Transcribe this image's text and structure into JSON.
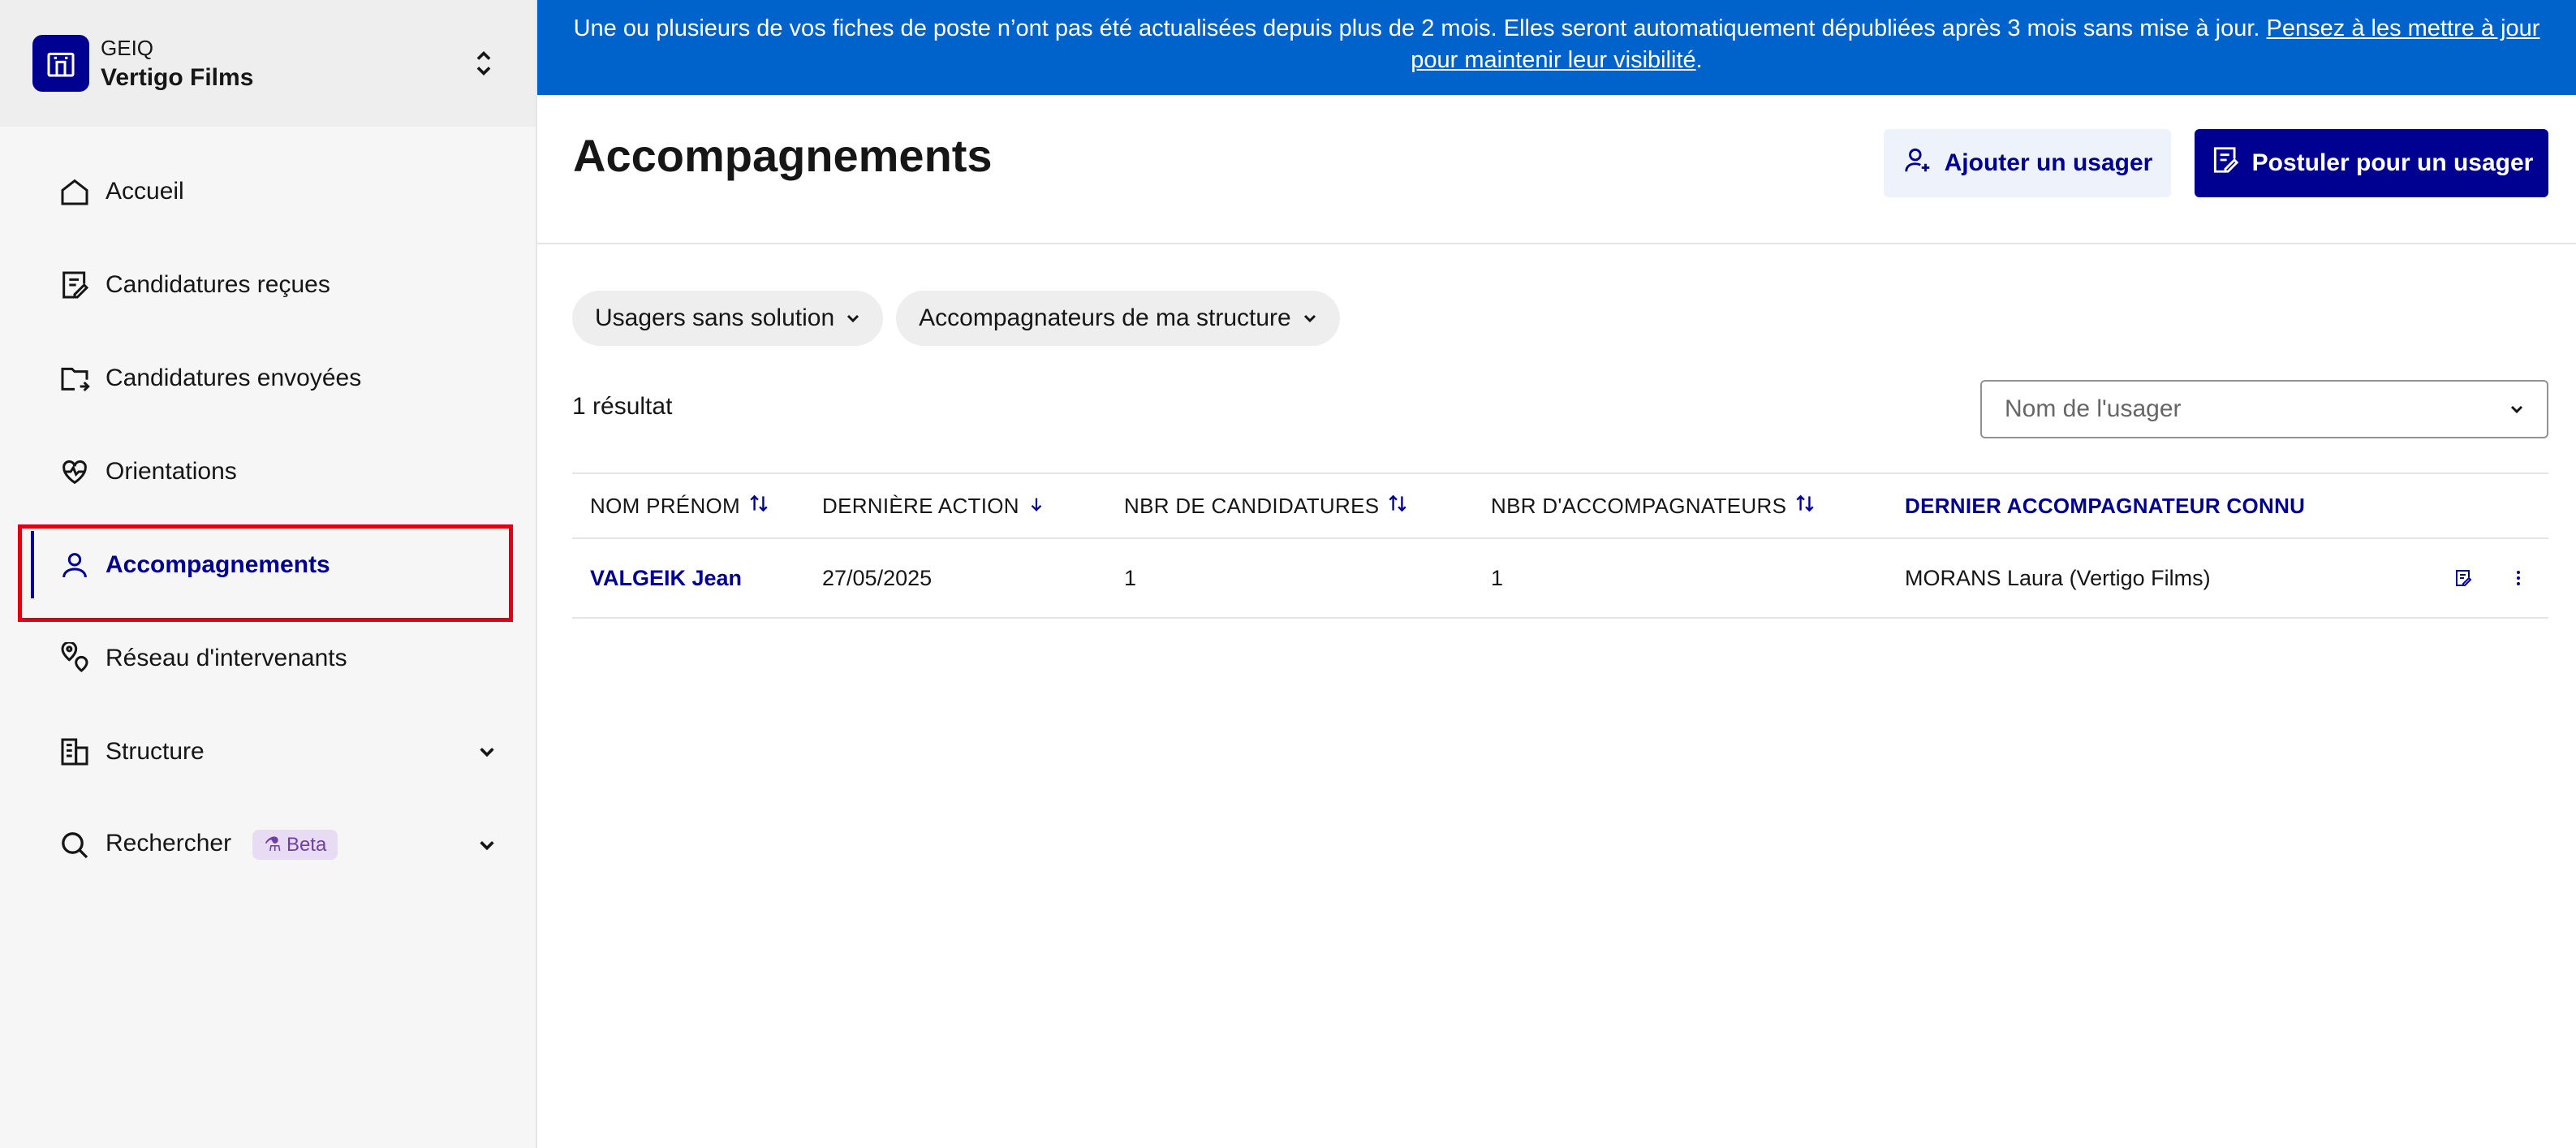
{
  "org": {
    "type": "GEIQ",
    "name": "Vertigo Films"
  },
  "nav": {
    "items": [
      {
        "label": "Accueil"
      },
      {
        "label": "Candidatures reçues"
      },
      {
        "label": "Candidatures envoyées"
      },
      {
        "label": "Orientations"
      },
      {
        "label": "Accompagnements"
      },
      {
        "label": "Réseau d'intervenants"
      },
      {
        "label": "Structure"
      },
      {
        "label": "Rechercher",
        "badge": "Beta"
      }
    ]
  },
  "banner": {
    "text": "Une ou plusieurs de vos fiches de poste n’ont pas été actualisées depuis plus de 2 mois. Elles seront automatiquement dépubliées après 3 mois sans mise à jour. ",
    "link": "Pensez à les mettre à jour pour maintenir leur visibilité",
    "end": "."
  },
  "header": {
    "title": "Accompagnements",
    "add_user": "Ajouter un usager",
    "apply_user": "Postuler pour un usager"
  },
  "filters": [
    {
      "label": "Usagers sans solution"
    },
    {
      "label": "Accompagnateurs de ma structure"
    }
  ],
  "result_count": "1 résultat",
  "search": {
    "placeholder": "Nom de l'usager"
  },
  "table": {
    "columns": [
      "NOM PRÉNOM",
      "DERNIÈRE ACTION",
      "NBR DE CANDIDATURES",
      "NBR D'ACCOMPAGNATEURS",
      "DERNIER ACCOMPAGNATEUR CONNU"
    ],
    "rows": [
      {
        "name": "VALGEIK Jean",
        "last_action": "27/05/2025",
        "applications": "1",
        "companions": "1",
        "last_companion": "MORANS Laura (Vertigo Films)"
      }
    ]
  },
  "colors": {
    "brand": "#000091",
    "banner": "#0063cb",
    "highlight": "#e1000f"
  }
}
